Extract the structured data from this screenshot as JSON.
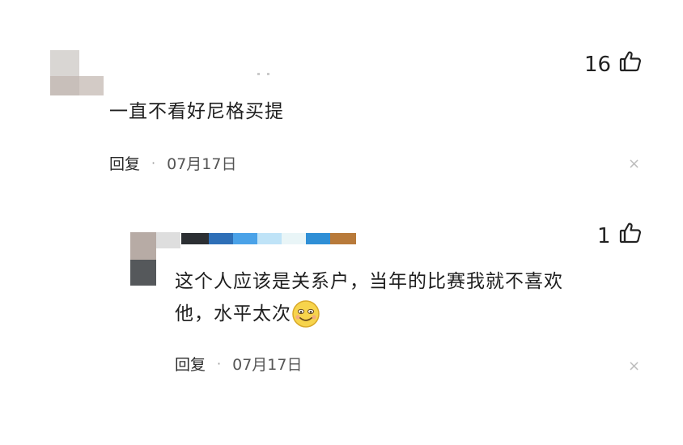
{
  "comment": {
    "text": "一直不看好尼格买提",
    "likes": "16",
    "reply_label": "回复",
    "separator": "·",
    "date": "07月17日",
    "close_symbol": "×",
    "like_icon": "thumbs-up-icon"
  },
  "reply": {
    "text_line1": "这个人应该是关系户，当年的比赛我就不喜欢",
    "text_line2": "他，水平太次",
    "emoji": "smile-emoji",
    "likes": "1",
    "reply_label": "回复",
    "separator": "·",
    "date": "07月17日",
    "close_symbol": "×",
    "like_icon": "thumbs-up-icon"
  },
  "colors": {
    "text": "#1f1f1f",
    "meta": "#555555",
    "muted": "#bdbdbd"
  }
}
